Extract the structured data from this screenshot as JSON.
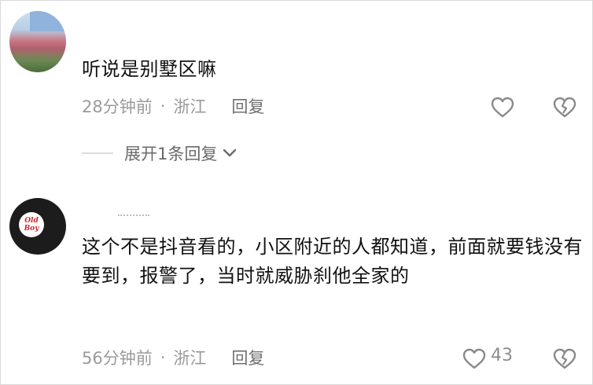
{
  "comments": [
    {
      "text": "听说是别墅区嘛",
      "time": "28分钟前",
      "separator": "·",
      "location": "浙江",
      "reply_label": "回复",
      "like_icon": "heart-outline-icon",
      "dislike_icon": "broken-heart-icon"
    },
    {
      "text": "这个不是抖音看的，小区附近的人都知道，前面就要钱没有要到，报警了，当时就威胁刹他全家的",
      "time": "56分钟前",
      "separator": "·",
      "location": "浙江",
      "reply_label": "回复",
      "like_count": "43",
      "like_icon": "heart-outline-icon",
      "dislike_icon": "broken-heart-icon",
      "avatar_badge_text": "Old Boy"
    }
  ],
  "expand_replies_label": "展开1条回复",
  "colors": {
    "text": "#111111",
    "meta": "#9a9a9a",
    "icon": "#8a8a8a"
  }
}
